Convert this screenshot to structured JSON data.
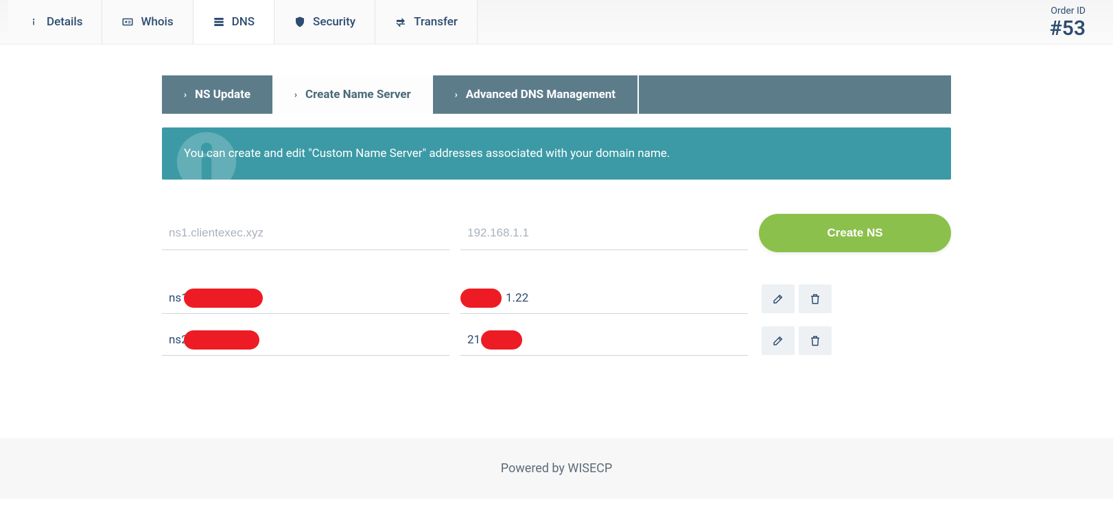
{
  "order": {
    "label": "Order ID",
    "id": "#53"
  },
  "top_tabs": {
    "details": "Details",
    "whois": "Whois",
    "dns": "DNS",
    "security": "Security",
    "transfer": "Transfer"
  },
  "sub_tabs": {
    "ns_update": "NS Update",
    "create_ns": "Create Name Server",
    "advanced": "Advanced DNS Management"
  },
  "info_text": "You can create and edit \"Custom Name Server\" addresses associated with your domain name.",
  "form": {
    "hostname_placeholder": "ns1.clientexec.xyz",
    "ip_placeholder": "192.168.1.1",
    "create_label": "Create NS"
  },
  "ns_records": [
    {
      "host_prefix": "ns1",
      "ip_visible": "1.22"
    },
    {
      "host_prefix": "ns2",
      "ip_visible": "21."
    }
  ],
  "footer": "Powered by WISECP"
}
